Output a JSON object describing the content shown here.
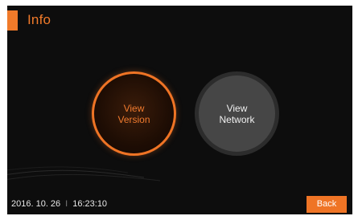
{
  "header": {
    "title": "Info"
  },
  "buttons": {
    "version": {
      "line1": "View",
      "line2": "Version"
    },
    "network": {
      "line1": "View",
      "line2": "Network"
    }
  },
  "footer": {
    "date": "2016. 10. 26",
    "separator": "I",
    "time": "16:23:10",
    "back_label": "Back"
  },
  "colors": {
    "accent": "#ef7425",
    "background": "#0d0d0d",
    "network_button": "#464646"
  }
}
